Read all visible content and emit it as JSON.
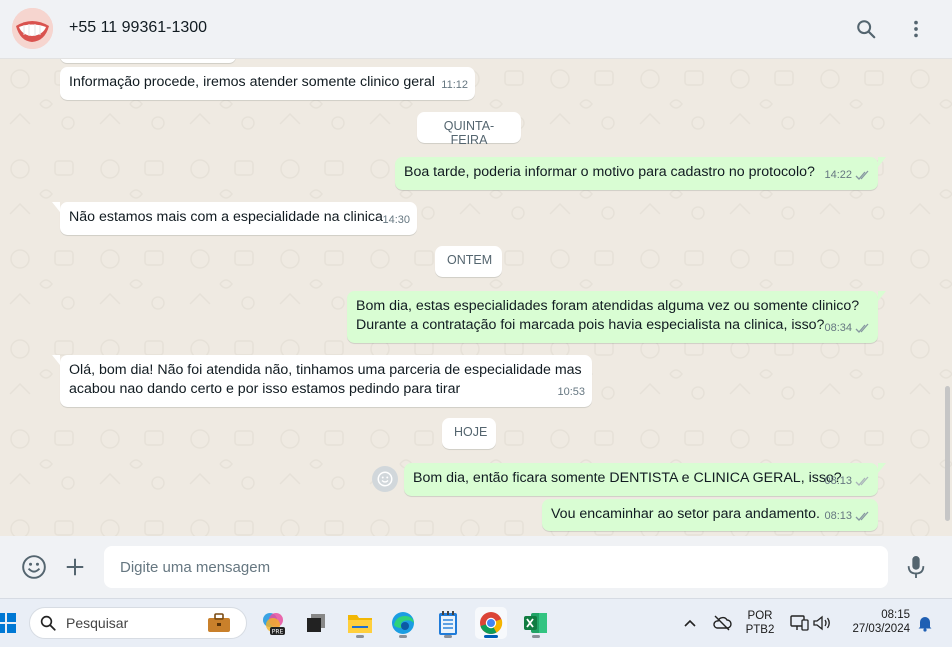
{
  "header": {
    "contact_name": "+55 11 99361-1300",
    "search_icon": "search-icon",
    "menu_icon": "kebab-menu-icon"
  },
  "chat": {
    "day_chips": [
      "QUINTA-FEIRA",
      "ONTEM",
      "HOJE"
    ],
    "messages": [
      {
        "dir": "in",
        "text": "Informação procede, iremos atender somente clinico geral",
        "time": "11:12"
      },
      {
        "dir": "out",
        "text": "Boa tarde, poderia informar o motivo para cadastro no protocolo?",
        "time": "14:22",
        "status": "read"
      },
      {
        "dir": "in",
        "text": "Não estamos mais com a especialidade na clinica",
        "time": "14:30"
      },
      {
        "dir": "out",
        "text_line1": "Bom dia, estas especialidades foram atendidas alguma vez ou somente clinico?",
        "text_line2": "Durante a contratação foi marcada pois havia especialista na clinica, isso?",
        "time": "08:34",
        "status": "read"
      },
      {
        "dir": "in",
        "text_line1": "Olá, bom dia! Não foi atendida não, tinhamos uma parceria de especialidade mas",
        "text_line2": "acabou nao dando certo e por isso estamos pedindo para tirar",
        "time": "10:53"
      },
      {
        "dir": "out",
        "text": "Bom dia, então ficara somente DENTISTA e CLINICA GERAL, isso?",
        "time": "08:13",
        "status": "delivered"
      },
      {
        "dir": "out",
        "text": "Vou encaminhar ao setor para andamento.",
        "time": "08:13",
        "status": "read"
      }
    ]
  },
  "composer": {
    "placeholder": "Digite uma mensagem",
    "emoji_icon": "emoji-icon",
    "attach_icon": "plus-icon",
    "mic_icon": "microphone-icon"
  },
  "taskbar": {
    "search_placeholder": "Pesquisar",
    "apps": [
      "windows-start-icon",
      "briefcase-icon",
      "copilot-pre-icon",
      "task-view-icon",
      "file-explorer-icon",
      "edge-browser-icon",
      "notepad-icon",
      "chrome-icon",
      "excel-icon"
    ],
    "tray": {
      "lang_line1": "POR",
      "lang_line2": "PTB2",
      "time": "08:15",
      "date": "27/03/2024"
    }
  },
  "colors": {
    "chat_bg": "#efeae2",
    "incoming_bubble": "#ffffff",
    "outgoing_bubble": "#d9fdd3",
    "read_ticks": "#53bdeb",
    "header_bg": "#f0f2f5"
  }
}
